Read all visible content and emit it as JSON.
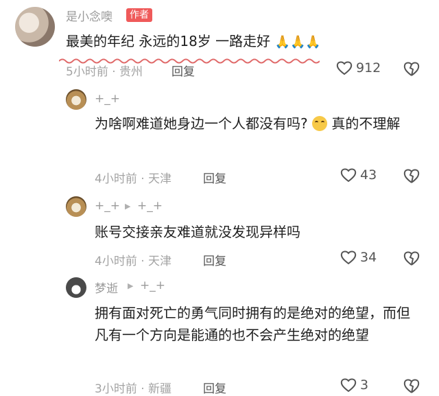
{
  "comments": [
    {
      "username": "是小念噢",
      "badge": "作者",
      "text": "最美的年纪 永远的18岁 一路走好",
      "emoji": "🙏🙏🙏",
      "time": "5小时前",
      "location": "贵州",
      "reply_label": "回复",
      "likes": "912"
    },
    {
      "username": "+_+",
      "text_before_emoji": "为啥啊难道她身边一个人都没有吗?",
      "text_after_emoji": "真的不理解",
      "time": "4小时前",
      "location": "天津",
      "reply_label": "回复",
      "likes": "43"
    },
    {
      "username": "+_+",
      "reply_to": "+_+",
      "text": "账号交接亲友难道就没发现异样吗",
      "time": "4小时前",
      "location": "天津",
      "reply_label": "回复",
      "likes": "34"
    },
    {
      "username": "梦逝",
      "reply_to": "+_+",
      "text": "拥有面对死亡的勇气同时拥有的是绝对的绝望，而但凡有一个方向是能通的也不会产生绝对的绝望",
      "time": "3小时前",
      "location": "新疆",
      "reply_label": "回复",
      "likes": "3"
    }
  ],
  "colors": {
    "author_badge": "#ef5a5a",
    "highlight_wave": "#e06a6a"
  }
}
